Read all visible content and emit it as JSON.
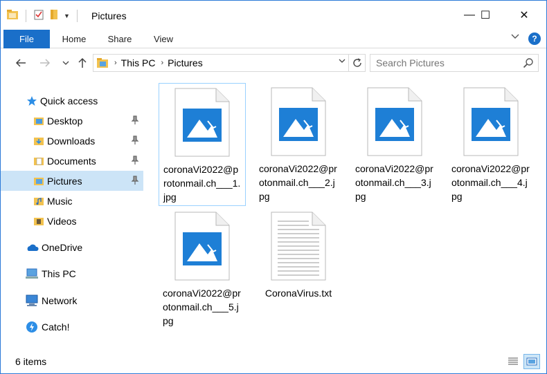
{
  "window": {
    "title": "Pictures",
    "minimize": "—",
    "maximize": "☐",
    "close": "✕"
  },
  "ribbon": {
    "tabs": [
      "File",
      "Home",
      "Share",
      "View"
    ],
    "help": "?"
  },
  "address": {
    "crumbs": [
      "This PC",
      "Pictures"
    ]
  },
  "search": {
    "placeholder": "Search Pictures"
  },
  "nav": {
    "quick_access": "Quick access",
    "items": [
      "Desktop",
      "Downloads",
      "Documents",
      "Pictures",
      "Music",
      "Videos"
    ],
    "onedrive": "OneDrive",
    "this_pc": "This PC",
    "network": "Network",
    "catch": "Catch!"
  },
  "files": [
    {
      "name": "coronaVi2022@protonmail.ch___1.jpg",
      "type": "image"
    },
    {
      "name": "coronaVi2022@protonmail.ch___2.jpg",
      "type": "image"
    },
    {
      "name": "coronaVi2022@protonmail.ch___3.jpg",
      "type": "image"
    },
    {
      "name": "coronaVi2022@protonmail.ch___4.jpg",
      "type": "image"
    },
    {
      "name": "coronaVi2022@protonmail.ch___5.jpg",
      "type": "image"
    },
    {
      "name": "CoronaVirus.txt",
      "type": "text"
    }
  ],
  "status": {
    "count": "6 items"
  },
  "colors": {
    "accent": "#1a6fc9",
    "selected": "#cce4f7",
    "image_blue": "#1e7fd6"
  }
}
